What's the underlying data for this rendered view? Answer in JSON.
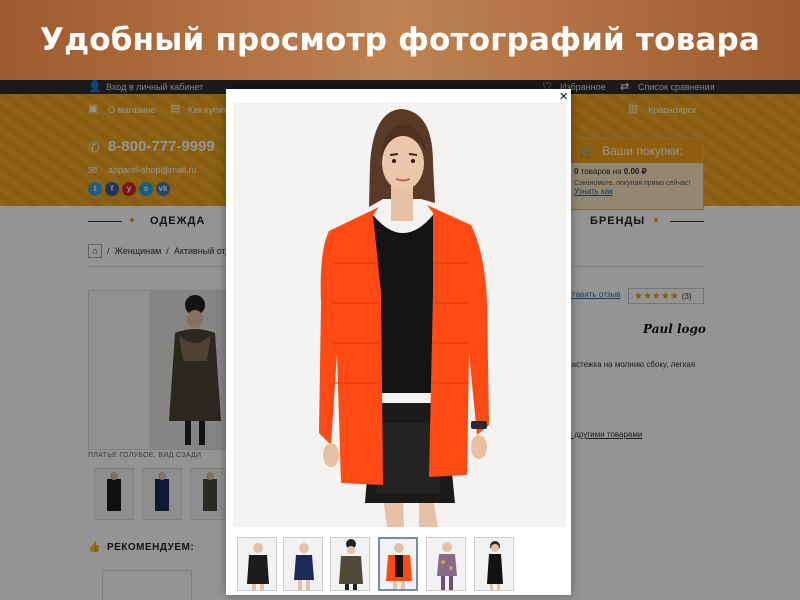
{
  "banner": {
    "title": "Удобный просмотр фотографий товара"
  },
  "header": {
    "account_link": "Вход в личный кабинет",
    "favorites_link": "Избранное",
    "compare_list_link": "Список сравнения",
    "about_shop_link": "О магазине",
    "how_to_buy_link": "Как купить",
    "city": "Красноярск",
    "phone": "8-800-777-9999",
    "email": "apparel-shop@mail.ru",
    "social": [
      "t",
      "f",
      "y",
      "s",
      "vk"
    ]
  },
  "cart": {
    "title": "Ваши покупки:",
    "items_count": "0",
    "items_text": "товаров на",
    "total": "0.00 ₽",
    "promo_text": "Сэкономьте, покупая прямо сейчас!",
    "promo_link": "Узнать как"
  },
  "nav": {
    "items": [
      "ОДЕЖДА",
      "БРЕНДЫ"
    ]
  },
  "breadcrumb": {
    "items": [
      "Женщинам",
      "Активный отдых"
    ]
  },
  "product": {
    "image_caption": "ПЛАТЬЕ ГОЛУБОЕ, ВИД СЗАДИ",
    "review_link": "ставить отзыв",
    "rating_stars": 5,
    "review_count": "(3)",
    "brand_logo": "Paul logo",
    "description_snippet": "застежка на молнию сбоку, легкая",
    "compare_snippet": "с другими товарами"
  },
  "recommend": {
    "title": "РЕКОМЕНДУЕМ:"
  },
  "colors": {
    "header_orange": "#f3a61c",
    "cardigan": "#ff4a14",
    "top_black": "#141414",
    "link_blue": "#1a6aa8"
  },
  "gallery": {
    "close_icon": "×",
    "selected_index": 3,
    "thumbnails": [
      {
        "outfit": "black coat",
        "color": "#1b1b1b"
      },
      {
        "outfit": "navy dress",
        "color": "#1c2a5a"
      },
      {
        "outfit": "olive coat with beanie",
        "color": "#4f4a3a"
      },
      {
        "outfit": "orange cardigan",
        "color": "#ff4a14"
      },
      {
        "outfit": "floral outfit",
        "color": "#8a6a88"
      },
      {
        "outfit": "black dress",
        "color": "#121212"
      }
    ]
  }
}
